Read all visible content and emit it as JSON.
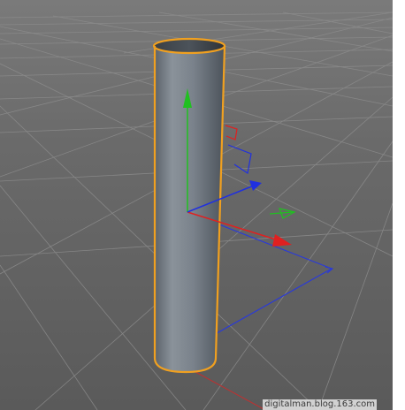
{
  "viewport": {
    "background": "#5e5e5e",
    "grid_color": "#8a8a8a"
  },
  "object": {
    "type": "cylinder",
    "selected": true,
    "selection_color": "#f0a020",
    "body_color": "#737a82"
  },
  "gizmo": {
    "x_axis_color": "#e02020",
    "y_axis_color": "#20c020",
    "z_axis_color": "#2030e0",
    "icon": "move-axis-gizmo-icon"
  },
  "watermark": {
    "text": "digitalman.blog.163.com"
  }
}
